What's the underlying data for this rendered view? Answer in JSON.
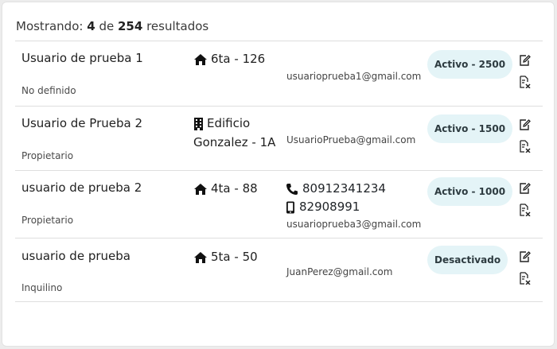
{
  "summary": {
    "prefix": "Mostrando:",
    "shown": "4",
    "of": "de",
    "total": "254",
    "suffix": "resultados"
  },
  "rows": [
    {
      "name": "Usuario de prueba 1",
      "role": "No definido",
      "address_icon": "house-icon",
      "address": [
        "6ta - 126"
      ],
      "phones": [],
      "email": "usuarioprueba1@gmail.com",
      "status": "Activo - 2500"
    },
    {
      "name": "Usuario de Prueba 2",
      "role": "Propietario",
      "address_icon": "building-icon",
      "address": [
        "Edificio",
        "Gonzalez - 1A"
      ],
      "phones": [],
      "email": "UsuarioPrueba@gmail.com",
      "status": "Activo - 1500"
    },
    {
      "name": "usuario de prueba 2",
      "role": "Propietario",
      "address_icon": "house-icon",
      "address": [
        "4ta - 88"
      ],
      "phones": [
        {
          "icon": "phone-icon",
          "number": "80912341234"
        },
        {
          "icon": "mobile-icon",
          "number": "82908991"
        }
      ],
      "email": "usuarioprueba3@gmail.com",
      "status": "Activo - 1000"
    },
    {
      "name": "usuario de prueba",
      "role": "Inquilino",
      "address_icon": "house-icon",
      "address": [
        "5ta - 50"
      ],
      "phones": [],
      "email": "JuanPerez@gmail.com",
      "status": "Desactivado"
    }
  ],
  "icons": {
    "edit": "edit-icon",
    "delete": "delete-icon"
  },
  "colors": {
    "badge_bg": "#e4f4f7",
    "badge_text": "#2d3b40"
  }
}
